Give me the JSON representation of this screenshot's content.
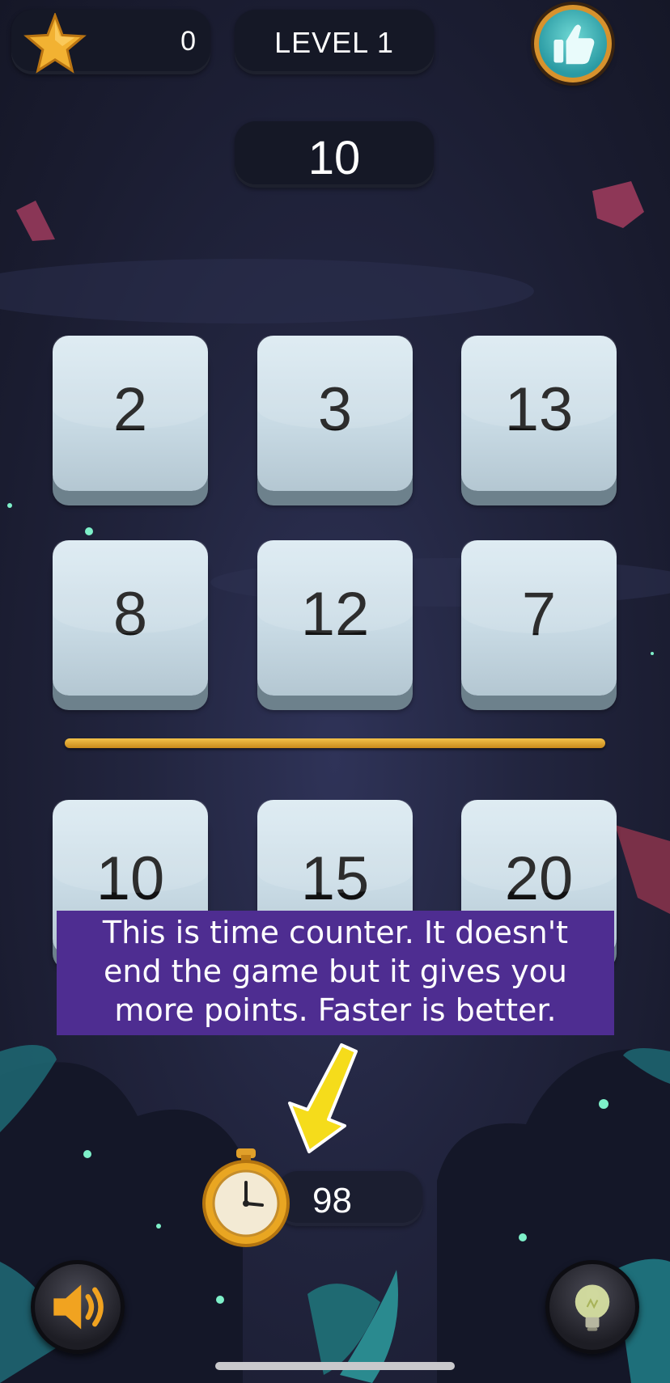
{
  "hud": {
    "score": "0",
    "level": "LEVEL 1",
    "target": "10",
    "like_icon": "thumbs-up-icon",
    "star_icon": "star-icon"
  },
  "tiles": {
    "row1": [
      "2",
      "3",
      "13"
    ],
    "row2": [
      "8",
      "12",
      "7"
    ],
    "row3": [
      "10",
      "15",
      "20"
    ]
  },
  "hint": {
    "line1": "This is time counter. It doesn't",
    "line2": "end the game but it gives you",
    "line3": "more points. Faster is better."
  },
  "timer": {
    "value": "98",
    "icon": "stopwatch-icon"
  },
  "controls": {
    "sound_icon": "speaker-icon",
    "hint_icon": "lightbulb-icon"
  },
  "colors": {
    "hint_bg": "#4e2d91",
    "divider": "#e0a530",
    "tile": "#cfe0e9"
  }
}
